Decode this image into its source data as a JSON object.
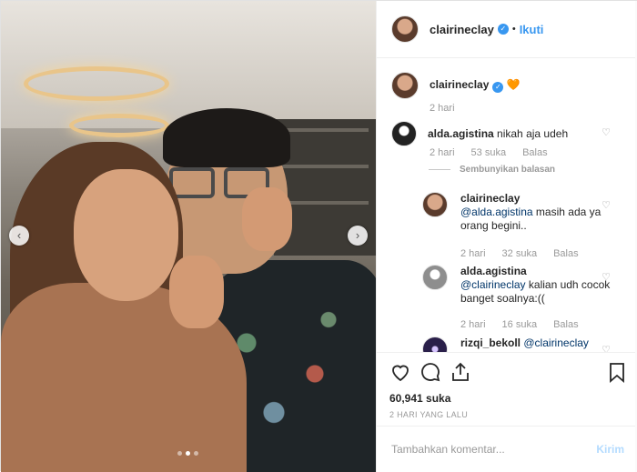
{
  "post": {
    "author": "clairineclay",
    "follow_label": "Ikuti",
    "separator": "•"
  },
  "caption": {
    "username": "clairineclay",
    "emoji": "🧡",
    "time": "2 hari"
  },
  "comments": [
    {
      "username": "alda.agistina",
      "text": "nikah aja udeh",
      "time": "2 hari",
      "likes": "53 suka",
      "reply": "Balas",
      "avatar": "dark"
    },
    {
      "username": "clairineclay",
      "mention": "@alda.agistina",
      "text": "masih ada ya orang begini..",
      "time": "2 hari",
      "likes": "32 suka",
      "reply": "Balas",
      "avatar": "woman"
    },
    {
      "username": "alda.agistina",
      "mention": "@clairineclay",
      "text": "kalian udh cocok banget soalnya:((",
      "time": "2 hari",
      "likes": "16 suka",
      "reply": "Balas",
      "avatar": "grey"
    },
    {
      "username": "rizqi_bekoll",
      "mention": "@clairineclay",
      "text": "",
      "avatar": "purple"
    }
  ],
  "hide_replies": "Sembunyikan balasan",
  "likes_count": "60,941 suka",
  "timestamp": "2 HARI YANG LALU",
  "comment_box": {
    "placeholder": "Tambahkan komentar...",
    "send_label": "Kirim"
  },
  "icons": {
    "prev": "chevron-left-icon",
    "next": "chevron-right-icon",
    "like": "heart-icon",
    "comment": "comment-icon",
    "share": "share-icon",
    "save": "bookmark-icon"
  },
  "colors": {
    "accent": "#3897f0",
    "emoji": "#ed7a2f",
    "mention": "#003569",
    "send_disabled": "#b3dbff"
  }
}
